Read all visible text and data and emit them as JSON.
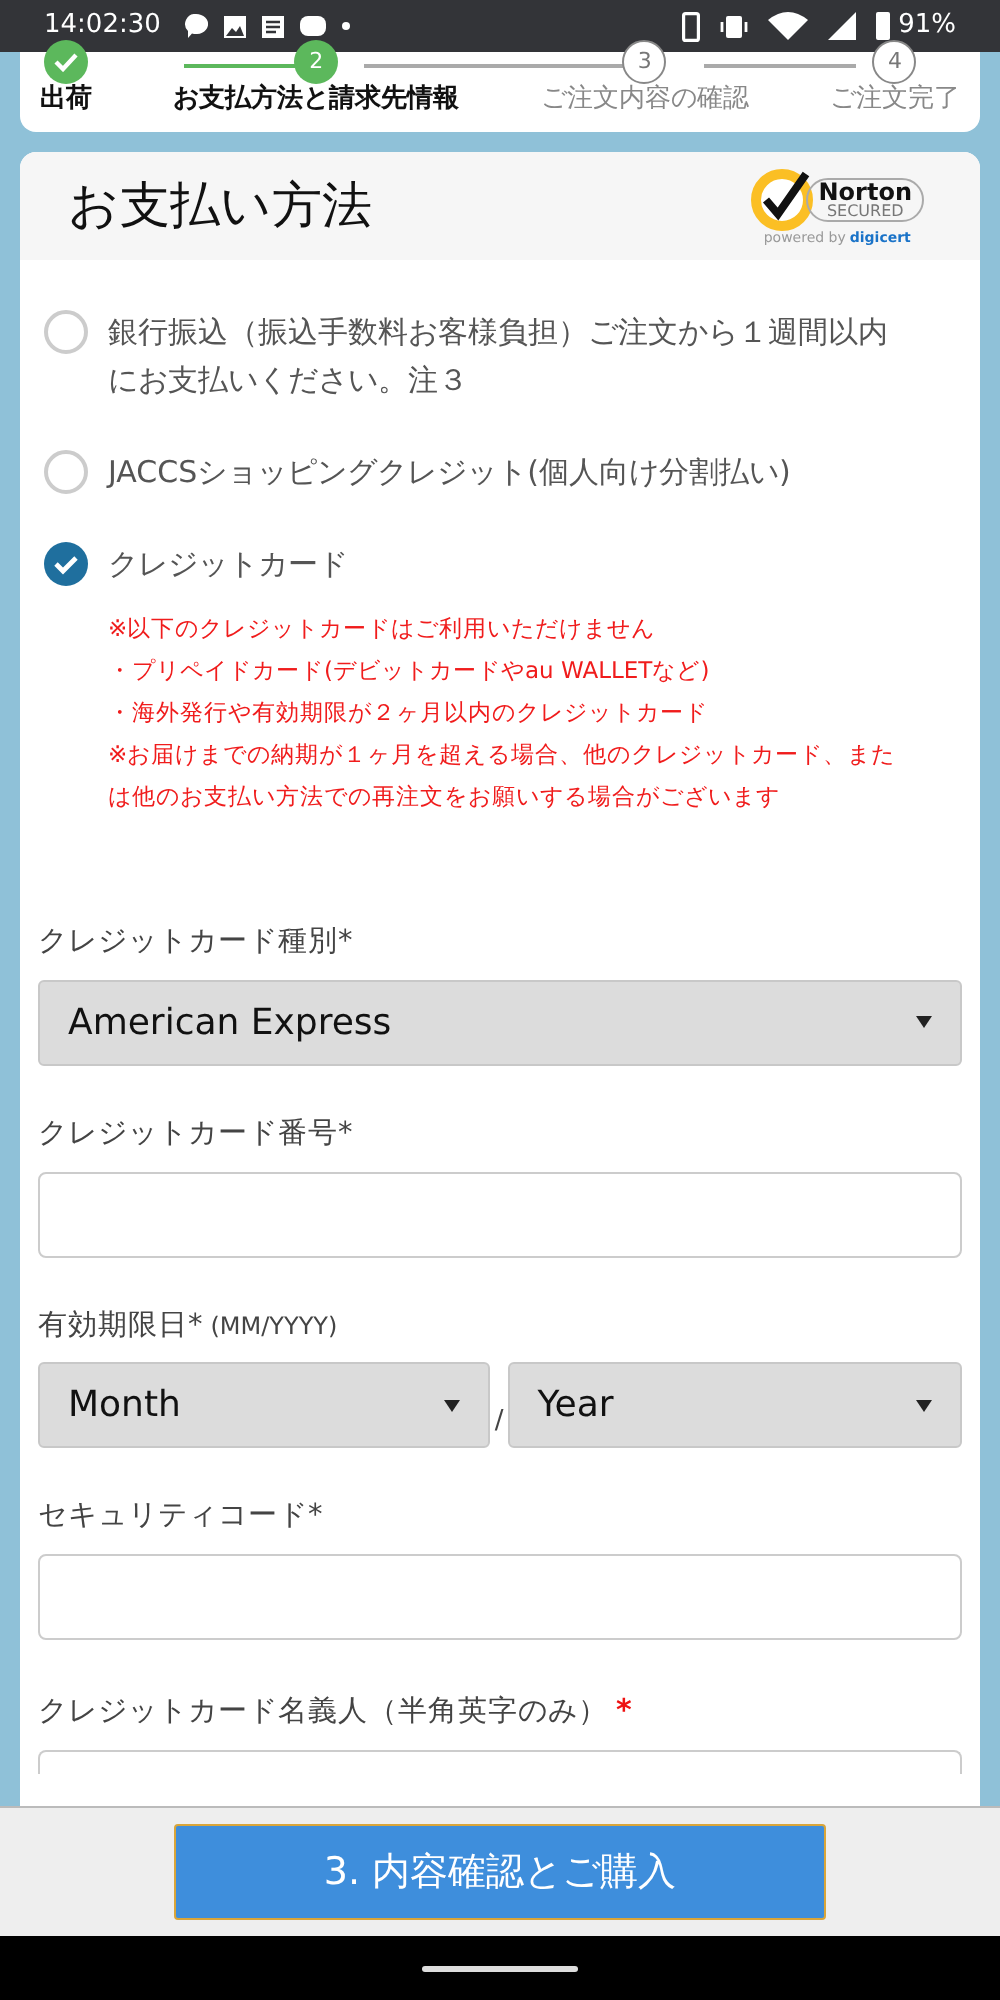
{
  "status_bar": {
    "time": "14:02:30",
    "battery": "91%"
  },
  "steps": [
    {
      "label": "出荷",
      "done": true,
      "selected": false
    },
    {
      "number": "2",
      "label": "お支払方法と請求先情報",
      "done": false,
      "selected": true
    },
    {
      "number": "3",
      "label": "ご注文内容の確認",
      "done": false,
      "selected": false
    },
    {
      "number": "4",
      "label": "ご注文完了",
      "done": false,
      "selected": false
    }
  ],
  "payment": {
    "title": "お支払い方法",
    "badge": {
      "brand": "Norton",
      "secured": "SECURED",
      "powered": "powered by",
      "by": "digicert"
    },
    "options": [
      {
        "label": "銀行振込（振込手数料お客様負担）ご注文から１週間以内にお支払いください。注３",
        "selected": false
      },
      {
        "label": "JACCSショッピングクレジット(個人向け分割払い)",
        "selected": false
      },
      {
        "label": "クレジットカード",
        "selected": true,
        "notes": [
          "※以下のクレジットカードはご利用いただけません",
          "・プリペイドカード(デビットカードやau WALLETなど)",
          "・海外発行や有効期限が２ヶ月以内のクレジットカード",
          "※お届けまでの納期が１ヶ月を超える場合、他のクレジットカード、または他のお支払い方法での再注文をお願いする場合がございます"
        ]
      }
    ]
  },
  "fields": [
    {
      "kind": "select",
      "label": "クレジットカード種別*",
      "value": "American Express"
    },
    {
      "kind": "input",
      "label": "クレジットカード番号*"
    },
    {
      "kind": "date",
      "label": "有効期限日*",
      "hint": "(MM/YYYY)",
      "month": "Month",
      "separator": "/",
      "year": "Year"
    },
    {
      "kind": "input",
      "label": "セキュリティコード*"
    },
    {
      "kind": "input",
      "label": "クレジットカード名義人（半角英字のみ）",
      "required_mark": "*"
    }
  ],
  "submit_button": "3. 内容確認とご購入"
}
